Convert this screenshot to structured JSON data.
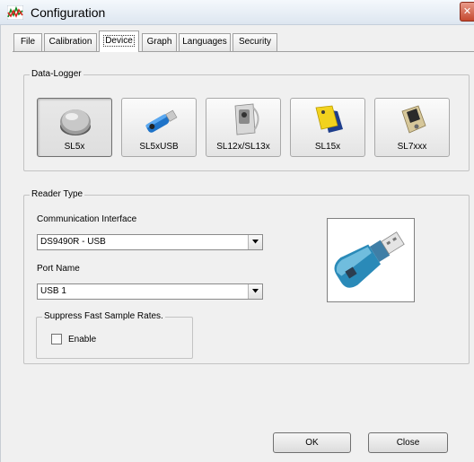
{
  "window": {
    "title": "Configuration",
    "close_glyph": "✕",
    "app_icon": "chart-icon"
  },
  "tabs": [
    {
      "label": "File",
      "active": false
    },
    {
      "label": "Calibration",
      "active": false
    },
    {
      "label": "Device",
      "active": true
    },
    {
      "label": "Graph",
      "active": false
    },
    {
      "label": "Languages",
      "active": false
    },
    {
      "label": "Security",
      "active": false
    }
  ],
  "data_logger": {
    "title": "Data-Logger",
    "devices": [
      {
        "label": "SL5x",
        "icon": "button-logger-icon",
        "selected": true
      },
      {
        "label": "SL5xUSB",
        "icon": "usb-stick-icon",
        "selected": false
      },
      {
        "label": "SL12x/SL13x",
        "icon": "wall-logger-icon",
        "selected": false
      },
      {
        "label": "SL15x",
        "icon": "tag-logger-icon",
        "selected": false
      },
      {
        "label": "SL7xxx",
        "icon": "display-logger-icon",
        "selected": false
      }
    ]
  },
  "reader": {
    "title": "Reader Type",
    "comm_label": "Communication Interface",
    "comm_value": "DS9490R - USB",
    "port_label": "Port Name",
    "port_value": "USB 1",
    "suppress": {
      "title": "Suppress Fast Sample Rates.",
      "enable_label": "Enable",
      "checked": false
    },
    "preview_icon": "usb-reader-icon"
  },
  "buttons": {
    "ok": "OK",
    "close": "Close"
  },
  "colors": {
    "titlebar": "#dde6f0",
    "dialog_bg": "#f0f0f0",
    "close_red": "#c5492f"
  }
}
